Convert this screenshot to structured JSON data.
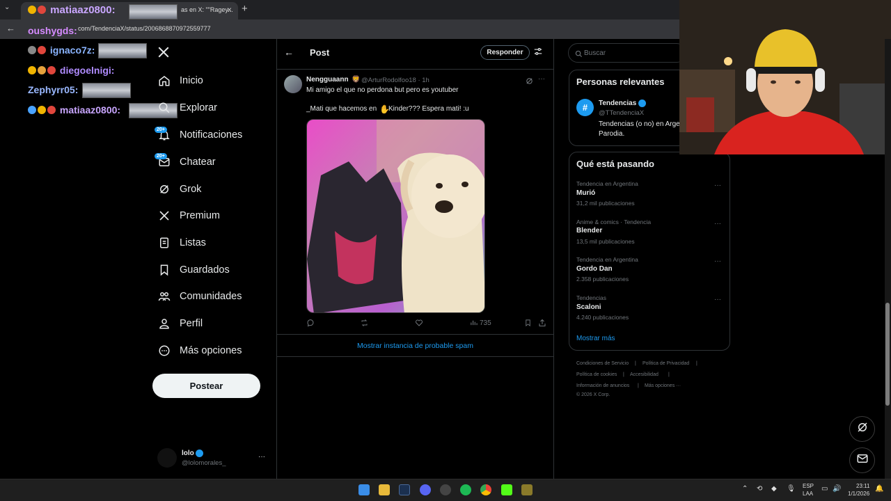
{
  "browser": {
    "tab_title": "as en X: \"\"Ragey...",
    "tab_close": "×",
    "new_tab": "+",
    "url": "com/TendenciaX/status/2006868870972559777"
  },
  "overlay_chat": [
    {
      "user": "matiaaz0800:",
      "color": "#c9a6ff"
    },
    {
      "user": "oushygds:",
      "color": "#d58bff"
    },
    {
      "user": "ignaco7z:",
      "color": "#8ab4ff"
    },
    {
      "user": "diegoelnigi:",
      "color": "#b08cff"
    },
    {
      "user": "Zephyrr05:",
      "color": "#9ab8ff"
    },
    {
      "user": "matiaaz0800:",
      "color": "#c9a6ff"
    }
  ],
  "nav": {
    "logo": "X",
    "items": [
      {
        "label": "Inicio"
      },
      {
        "label": "Explorar"
      },
      {
        "label": "Notificaciones",
        "badge": "20+"
      },
      {
        "label": "Chatear",
        "badge": "20+"
      },
      {
        "label": "Grok"
      },
      {
        "label": "Premium"
      },
      {
        "label": "Listas"
      },
      {
        "label": "Guardados"
      },
      {
        "label": "Comunidades"
      },
      {
        "label": "Perfil"
      },
      {
        "label": "Más opciones"
      }
    ],
    "post_button": "Postear",
    "account": {
      "name": "lolo",
      "handle": "@lolomorales_",
      "more": "···"
    }
  },
  "main": {
    "header_title": "Post",
    "reply_button": "Responder",
    "tweet": {
      "author": "Nengguaann",
      "handle": "@ArturRodolfoo18 · 1h",
      "line1": "Mi amigo el que no perdona but pero es youtuber",
      "line2_a": "_Mati que hacemos en",
      "line2_b": "Kinder??? Espera mati! :u",
      "views": "735"
    },
    "spam_link": "Mostrar instancia de probable spam"
  },
  "sidebar": {
    "search_placeholder": "Buscar",
    "relevant": {
      "title": "Personas relevantes",
      "name": "Tendencias",
      "handle": "@TTendenciaX",
      "bio1": "Tendencias (o no) en Arge",
      "bio2": "Parodia."
    },
    "trends": {
      "title": "Qué está pasando",
      "items": [
        {
          "meta": "Tendencia en Argentina",
          "name": "Murió",
          "count": "31,2 mil publicaciones"
        },
        {
          "meta": "Anime & comics · Tendencia",
          "name": "Blender",
          "count": "13,5 mil publicaciones"
        },
        {
          "meta": "Tendencia en Argentina",
          "name": "Gordo Dan",
          "count": "2.358 publicaciones"
        },
        {
          "meta": "Tendencias",
          "name": "Scaloni",
          "count": "4.240 publicaciones"
        }
      ],
      "show_more": "Mostrar más"
    },
    "footer": {
      "l1a": "Condiciones de Servicio",
      "l1b": "Política de Privacidad",
      "l2a": "Política de cookies",
      "l2b": "Accesibilidad",
      "l3a": "Información de anuncios",
      "l3b": "Más opciones ···",
      "copyright": "© 2026 X Corp."
    }
  },
  "taskbar": {
    "lang1": "ESP",
    "lang2": "LAA",
    "time": "23:11",
    "date": "1/1/2026"
  },
  "colors": {
    "accent": "#1d9bf0",
    "bg": "#000000",
    "border": "#2f3336",
    "muted": "#71767b"
  }
}
